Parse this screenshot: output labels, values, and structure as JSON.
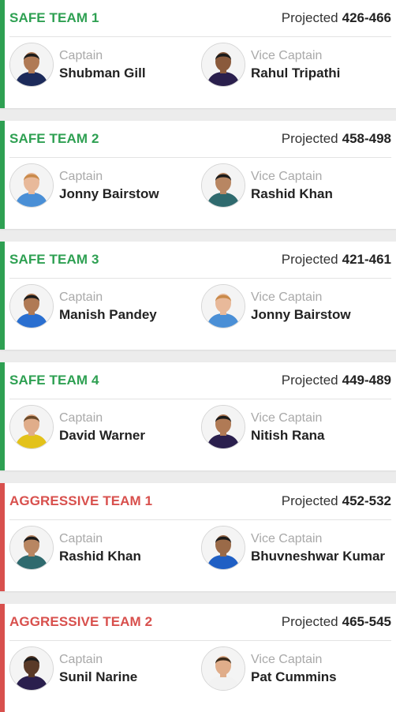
{
  "teams": [
    {
      "title": "SAFE TEAM 1",
      "type": "safe",
      "projected_label": "Projected",
      "projected_range": "426-466",
      "captain": {
        "role": "Captain",
        "name": "Shubman Gill",
        "jersey": "#1c2a5a",
        "hair": "#1b1b1b",
        "skin": "#b07a55"
      },
      "vice_captain": {
        "role": "Vice Captain",
        "name": "Rahul Tripathi",
        "jersey": "#2a1f4d",
        "hair": "#1b1b1b",
        "skin": "#8a5a3c"
      }
    },
    {
      "title": "SAFE TEAM 2",
      "type": "safe",
      "projected_label": "Projected",
      "projected_range": "458-498",
      "captain": {
        "role": "Captain",
        "name": "Jonny Bairstow",
        "jersey": "#4a8fd6",
        "hair": "#c98a4a",
        "skin": "#e8b99a"
      },
      "vice_captain": {
        "role": "Vice Captain",
        "name": "Rashid Khan",
        "jersey": "#2f6a6e",
        "hair": "#1b1b1b",
        "skin": "#b88662"
      }
    },
    {
      "title": "SAFE TEAM 3",
      "type": "safe",
      "projected_label": "Projected",
      "projected_range": "421-461",
      "captain": {
        "role": "Captain",
        "name": "Manish Pandey",
        "jersey": "#2a6fd0",
        "hair": "#1b1b1b",
        "skin": "#b07a55"
      },
      "vice_captain": {
        "role": "Vice Captain",
        "name": "Jonny Bairstow",
        "jersey": "#4a8fd6",
        "hair": "#c98a4a",
        "skin": "#e8b99a"
      }
    },
    {
      "title": "SAFE TEAM 4",
      "type": "safe",
      "projected_label": "Projected",
      "projected_range": "449-489",
      "captain": {
        "role": "Captain",
        "name": "David Warner",
        "jersey": "#e3c21a",
        "hair": "#6b4a2a",
        "skin": "#e0ad8a"
      },
      "vice_captain": {
        "role": "Vice Captain",
        "name": "Nitish Rana",
        "jersey": "#2a1f4d",
        "hair": "#1b1b1b",
        "skin": "#b07a55"
      }
    },
    {
      "title": "AGGRESSIVE TEAM 1",
      "type": "aggr",
      "projected_label": "Projected",
      "projected_range": "452-532",
      "captain": {
        "role": "Captain",
        "name": "Rashid Khan",
        "jersey": "#2f6a6e",
        "hair": "#1b1b1b",
        "skin": "#b88662"
      },
      "vice_captain": {
        "role": "Vice Captain",
        "name": "Bhuvneshwar Kumar",
        "jersey": "#1f5fc4",
        "hair": "#1b1b1b",
        "skin": "#9a6a48"
      }
    },
    {
      "title": "AGGRESSIVE TEAM 2",
      "type": "aggr",
      "projected_label": "Projected",
      "projected_range": "465-545",
      "captain": {
        "role": "Captain",
        "name": "Sunil Narine",
        "jersey": "#2a1f4d",
        "hair": "#1b1b1b",
        "skin": "#5a3a28"
      },
      "vice_captain": {
        "role": "Vice Captain",
        "name": "Pat Cummins",
        "jersey": "#f2f2f2",
        "hair": "#3a2a1a",
        "skin": "#e0ad8a"
      }
    }
  ]
}
